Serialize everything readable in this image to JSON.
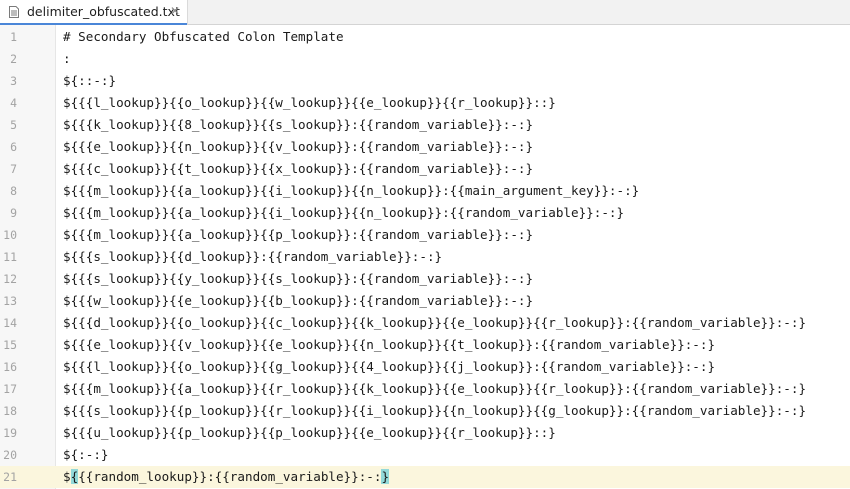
{
  "tab": {
    "file_name": "delimiter_obfuscated.txt",
    "close_glyph": "✕",
    "file_icon": "text-file-icon"
  },
  "colors": {
    "current_line": "#fbf6dd",
    "brace_match": "#93d9d9",
    "tab_accent": "#4a86d8"
  },
  "editor": {
    "current_line": 21,
    "lines": [
      {
        "number": "1",
        "text": "# Secondary Obfuscated Colon Template"
      },
      {
        "number": "2",
        "text": ":"
      },
      {
        "number": "3",
        "text": "${::-:}"
      },
      {
        "number": "4",
        "text": "${{{l_lookup}}{{o_lookup}}{{w_lookup}}{{e_lookup}}{{r_lookup}}::}"
      },
      {
        "number": "5",
        "text": "${{{k_lookup}}{{8_lookup}}{{s_lookup}}:{{random_variable}}:-:}"
      },
      {
        "number": "6",
        "text": "${{{e_lookup}}{{n_lookup}}{{v_lookup}}:{{random_variable}}:-:}"
      },
      {
        "number": "7",
        "text": "${{{c_lookup}}{{t_lookup}}{{x_lookup}}:{{random_variable}}:-:}"
      },
      {
        "number": "8",
        "text": "${{{m_lookup}}{{a_lookup}}{{i_lookup}}{{n_lookup}}:{{main_argument_key}}:-:}"
      },
      {
        "number": "9",
        "text": "${{{m_lookup}}{{a_lookup}}{{i_lookup}}{{n_lookup}}:{{random_variable}}:-:}"
      },
      {
        "number": "10",
        "text": "${{{m_lookup}}{{a_lookup}}{{p_lookup}}:{{random_variable}}:-:}"
      },
      {
        "number": "11",
        "text": "${{{s_lookup}}{{d_lookup}}:{{random_variable}}:-:}"
      },
      {
        "number": "12",
        "text": "${{{s_lookup}}{{y_lookup}}{{s_lookup}}:{{random_variable}}:-:}"
      },
      {
        "number": "13",
        "text": "${{{w_lookup}}{{e_lookup}}{{b_lookup}}:{{random_variable}}:-:}"
      },
      {
        "number": "14",
        "text": "${{{d_lookup}}{{o_lookup}}{{c_lookup}}{{k_lookup}}{{e_lookup}}{{r_lookup}}:{{random_variable}}:-:}"
      },
      {
        "number": "15",
        "text": "${{{e_lookup}}{{v_lookup}}{{e_lookup}}{{n_lookup}}{{t_lookup}}:{{random_variable}}:-:}"
      },
      {
        "number": "16",
        "text": "${{{l_lookup}}{{o_lookup}}{{g_lookup}}{{4_lookup}}{{j_lookup}}:{{random_variable}}:-:}"
      },
      {
        "number": "17",
        "text": "${{{m_lookup}}{{a_lookup}}{{r_lookup}}{{k_lookup}}{{e_lookup}}{{r_lookup}}:{{random_variable}}:-:}"
      },
      {
        "number": "18",
        "text": "${{{s_lookup}}{{p_lookup}}{{r_lookup}}{{i_lookup}}{{n_lookup}}{{g_lookup}}:{{random_variable}}:-:}"
      },
      {
        "number": "19",
        "text": "${{{u_lookup}}{{p_lookup}}{{p_lookup}}{{e_lookup}}{{r_lookup}}::}"
      },
      {
        "number": "20",
        "text": "${:-:}"
      },
      {
        "number": "21",
        "prefix": "$",
        "open_brace": "{",
        "middle": "{{random_lookup}}:{{random_variable}}:-:",
        "close_brace": "}"
      }
    ]
  }
}
